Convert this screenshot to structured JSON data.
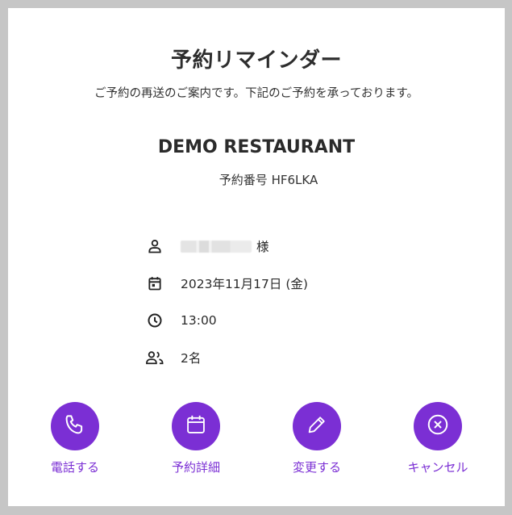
{
  "title": "予約リマインダー",
  "subtitle": "ご予約の再送のご案内です。下記のご予約を承っております。",
  "restaurant": "DEMO RESTAURANT",
  "reservation": {
    "label": "予約番号",
    "number": "HF6LKA"
  },
  "details": {
    "guest_suffix": "様",
    "date": "2023年11月17日 (金)",
    "time": "13:00",
    "party": "2名"
  },
  "icons": {
    "guest": "person-icon",
    "date": "calendar-icon",
    "time": "clock-icon",
    "party": "people-icon",
    "call": "phone-icon",
    "detail": "calendar-icon",
    "change": "pencil-icon",
    "cancel": "close-circle-icon"
  },
  "actions": {
    "call": "電話する",
    "detail": "予約詳細",
    "change": "変更する",
    "cancel": "キャンセル"
  },
  "colors": {
    "accent": "#7b2fd4",
    "background": "#c6c6c6",
    "card": "#ffffff"
  }
}
